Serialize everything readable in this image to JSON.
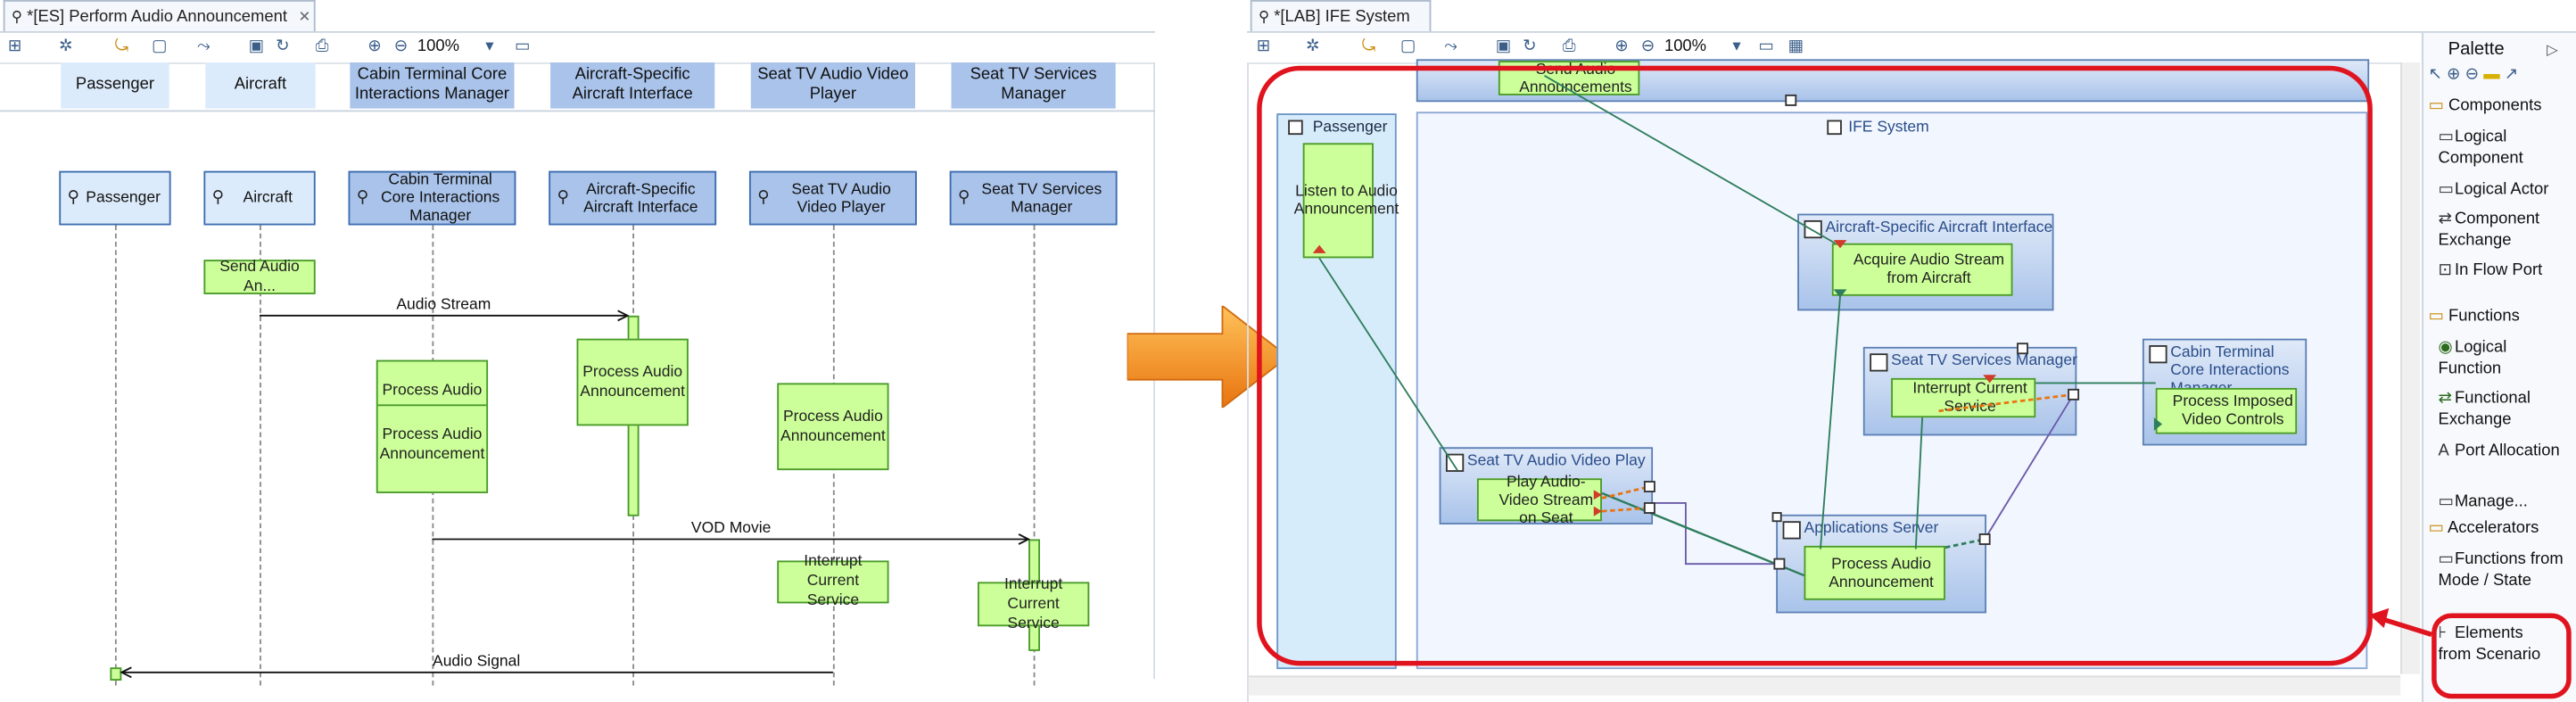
{
  "left_window": {
    "tab_title": "*[ES] Perform Audio Announcement",
    "zoom": "100%",
    "lifeline_headers": [
      "Passenger",
      "Aircraft",
      "Cabin Terminal Core Interactions Manager",
      "Aircraft-Specific Aircraft Interface",
      "Seat TV Audio Video Player",
      "Seat TV Services Manager"
    ],
    "lifelines": [
      "Passenger",
      "Aircraft",
      "Cabin Terminal Core Interactions Manager",
      "Aircraft-Specific Aircraft Interface",
      "Seat TV Audio Video Player",
      "Seat TV Services Manager"
    ],
    "functions": [
      "Send Audio An...",
      "Process Audio",
      "Process Audio Announcement",
      "Process Audio Announcement",
      "Process Audio Announcement",
      "Interrupt Current Service",
      "Interrupt Current Service"
    ],
    "messages": [
      "Audio Stream",
      "VOD Movie",
      "Audio Signal"
    ]
  },
  "right_window": {
    "tab_title": "*[LAB] IFE System",
    "zoom": "100%",
    "top_function": "Send Audio Announcements",
    "passenger_actor": "Passenger",
    "passenger_function": "Listen to Audio Announcement",
    "ife_system": "IFE System",
    "components": [
      {
        "name": "Aircraft-Specific Aircraft Interface",
        "function": "Acquire Audio Stream from Aircraft"
      },
      {
        "name": "Seat TV Services Manager",
        "function": "Interrupt Current Service"
      },
      {
        "name": "Cabin Terminal Core Interactions Manager",
        "function": "Process Imposed Video Controls"
      },
      {
        "name": "Seat TV Audio Video Play",
        "function": "Play Audio-Video Stream on Seat"
      },
      {
        "name": "Applications Server",
        "function": "Process Audio Announcement"
      }
    ]
  },
  "palette": {
    "title": "Palette",
    "sections": [
      {
        "name": "Components",
        "items": [
          "Logical Component",
          "Logical Actor",
          "Component Exchange",
          "In Flow Port"
        ]
      },
      {
        "name": "Functions",
        "items": [
          "Logical Function",
          "Functional Exchange",
          "Port Allocation",
          "Manage..."
        ]
      },
      {
        "name": "Accelerators",
        "items": [
          "Functions from Mode / State",
          "Elements from Scenario"
        ]
      }
    ]
  },
  "colors": {
    "function_fill": "#ccff99",
    "function_border": "#4a9a2a",
    "component_fill": "#a9c3ea",
    "highlight": "#e0141e",
    "arrow": "#f08a1c"
  }
}
